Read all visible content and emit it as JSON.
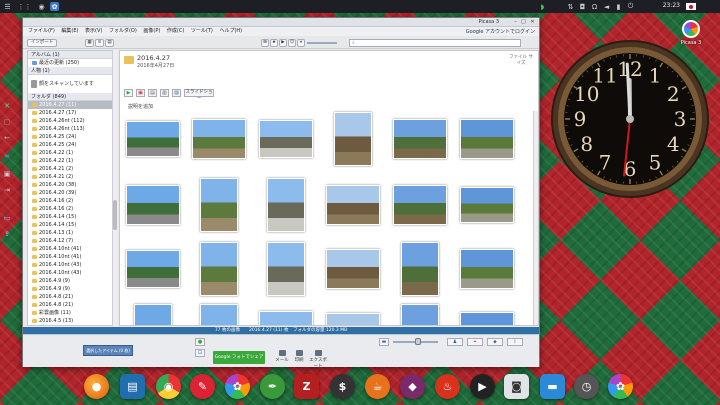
{
  "top_panel": {
    "clock": "23:23",
    "icons": [
      "grid-icon",
      "circle-icon",
      "picasa-icon",
      "rss-icon",
      "network-icon",
      "volume-icon",
      "battery-icon",
      "power-icon"
    ]
  },
  "desktop": {
    "picasa_label": "Picasa 3"
  },
  "window": {
    "title": "Picasa 3",
    "signin": "Google アカウントでログイン",
    "menu": [
      "ファイル(F)",
      "編集(E)",
      "表示(V)",
      "フォルダ(O)",
      "画像(P)",
      "作成(C)",
      "ツール(T)",
      "ヘルプ(H)"
    ],
    "toolbar": {
      "import": "インポート",
      "search_placeholder": ""
    },
    "sidebar": {
      "sections": {
        "albums": "アルバム (1)",
        "people": "人物 (1)",
        "folders": "フォルダ (849)"
      },
      "album_item": "最近の更新 (250)",
      "people_item": "顔をスキャンしています",
      "folders": [
        {
          "label": "2016.4.27 (11)",
          "selected": true
        },
        {
          "label": "2016.4.27 (17)",
          "selected": false
        },
        {
          "label": "2016.4.26nt (112)",
          "selected": false
        },
        {
          "label": "2016.4.26nt (113)",
          "selected": false
        },
        {
          "label": "2016.4.25 (24)",
          "selected": false
        },
        {
          "label": "2016.4.25 (24)",
          "selected": false
        },
        {
          "label": "2016.4.22 (1)",
          "selected": false
        },
        {
          "label": "2016.4.22 (1)",
          "selected": false
        },
        {
          "label": "2016.4.21 (2)",
          "selected": false
        },
        {
          "label": "2016.4.21 (2)",
          "selected": false
        },
        {
          "label": "2016.4.20 (38)",
          "selected": false
        },
        {
          "label": "2016.4.20 (39)",
          "selected": false
        },
        {
          "label": "2016.4.16 (2)",
          "selected": false
        },
        {
          "label": "2016.4.16 (2)",
          "selected": false
        },
        {
          "label": "2016.4.14 (15)",
          "selected": false
        },
        {
          "label": "2016.4.14 (15)",
          "selected": false
        },
        {
          "label": "2016.4.13 (1)",
          "selected": false
        },
        {
          "label": "2016.4.12 (7)",
          "selected": false
        },
        {
          "label": "2016.4.10nt (41)",
          "selected": false
        },
        {
          "label": "2016.4.10nt (41)",
          "selected": false
        },
        {
          "label": "2016.4.10nt (43)",
          "selected": false
        },
        {
          "label": "2016.4.10nt (43)",
          "selected": false
        },
        {
          "label": "2016.4.9 (9)",
          "selected": false
        },
        {
          "label": "2016.4.9 (9)",
          "selected": false
        },
        {
          "label": "2016.4.8 (21)",
          "selected": false
        },
        {
          "label": "2016.4.8 (21)",
          "selected": false
        },
        {
          "label": "彩雲画像 (11)",
          "selected": false
        },
        {
          "label": "2016.4.5 (13)",
          "selected": false
        }
      ]
    },
    "album": {
      "title": "2016.4.27",
      "date": "2016年4月27日",
      "description": "説明を追加",
      "size_label": "ファイル サイズ",
      "action_button": "スライドショー"
    },
    "status": "77 枚の画像　　2016.4.27 (11) 枚　フォルダの容量 120.3 MB",
    "tray": {
      "hold_label": "選択したアイテム (0 枚)",
      "share_button": "Google フォトでシェア",
      "actions": [
        "メール",
        "印刷",
        "エクスポート"
      ]
    }
  },
  "clock": {
    "hour": 11,
    "minute": 59,
    "second": 31
  },
  "dock": {
    "icons": [
      "firefox-icon",
      "files-icon",
      "chrome-icon",
      "pencil-icon",
      "picasa-icon",
      "pen-icon",
      "filezilla-icon",
      "terminal-icon",
      "teapot-icon",
      "inkscape-icon",
      "fire-icon",
      "media-player-icon",
      "screenshot-icon",
      "desktop-icon",
      "clock-icon",
      "picasa-icon"
    ]
  }
}
